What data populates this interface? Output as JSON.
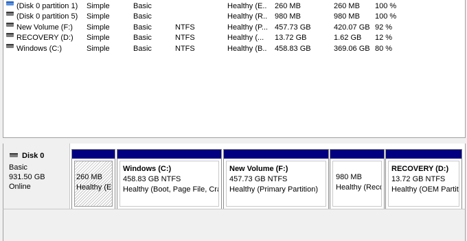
{
  "volumes": [
    {
      "icon": "partition-blue-icon",
      "name": "(Disk 0 partition 1)",
      "layout": "Simple",
      "type": "Basic",
      "fs": "",
      "status": "Healthy (E...",
      "capacity": "260 MB",
      "free": "260 MB",
      "pct": "100 %"
    },
    {
      "icon": "partition-icon",
      "name": "(Disk 0 partition 5)",
      "layout": "Simple",
      "type": "Basic",
      "fs": "",
      "status": "Healthy (R...",
      "capacity": "980 MB",
      "free": "980 MB",
      "pct": "100 %"
    },
    {
      "icon": "volume-icon",
      "name": "New Volume (F:)",
      "layout": "Simple",
      "type": "Basic",
      "fs": "NTFS",
      "status": "Healthy (P...",
      "capacity": "457.73 GB",
      "free": "420.07 GB",
      "pct": "92 %"
    },
    {
      "icon": "volume-icon",
      "name": "RECOVERY (D:)",
      "layout": "Simple",
      "type": "Basic",
      "fs": "NTFS",
      "status": "Healthy (...",
      "capacity": "13.72 GB",
      "free": "1.62 GB",
      "pct": "12 %"
    },
    {
      "icon": "volume-icon",
      "name": "Windows (C:)",
      "layout": "Simple",
      "type": "Basic",
      "fs": "NTFS",
      "status": "Healthy (B...",
      "capacity": "458.83 GB",
      "free": "369.06 GB",
      "pct": "80 %"
    }
  ],
  "disk": {
    "name": "Disk 0",
    "type": "Basic",
    "size": "931.50 GB",
    "status": "Online"
  },
  "partitions": [
    {
      "hatched": true,
      "title": "",
      "size": "260 MB",
      "status": "Healthy (EFI System Partition)"
    },
    {
      "hatched": false,
      "title": "Windows  (C:)",
      "size": "458.83 GB NTFS",
      "status": "Healthy (Boot, Page File, Crash Dump, Primary Partition)"
    },
    {
      "hatched": false,
      "title": "New Volume  (F:)",
      "size": "457.73 GB NTFS",
      "status": "Healthy (Primary Partition)"
    },
    {
      "hatched": false,
      "title": "",
      "size": "980 MB",
      "status": "Healthy (Recovery Partition)"
    },
    {
      "hatched": false,
      "title": "RECOVERY  (D:)",
      "size": "13.72 GB NTFS",
      "status": "Healthy (OEM Partition)"
    }
  ],
  "colors": {
    "partition_bar": "#000080",
    "background": "#f0f0f0"
  }
}
